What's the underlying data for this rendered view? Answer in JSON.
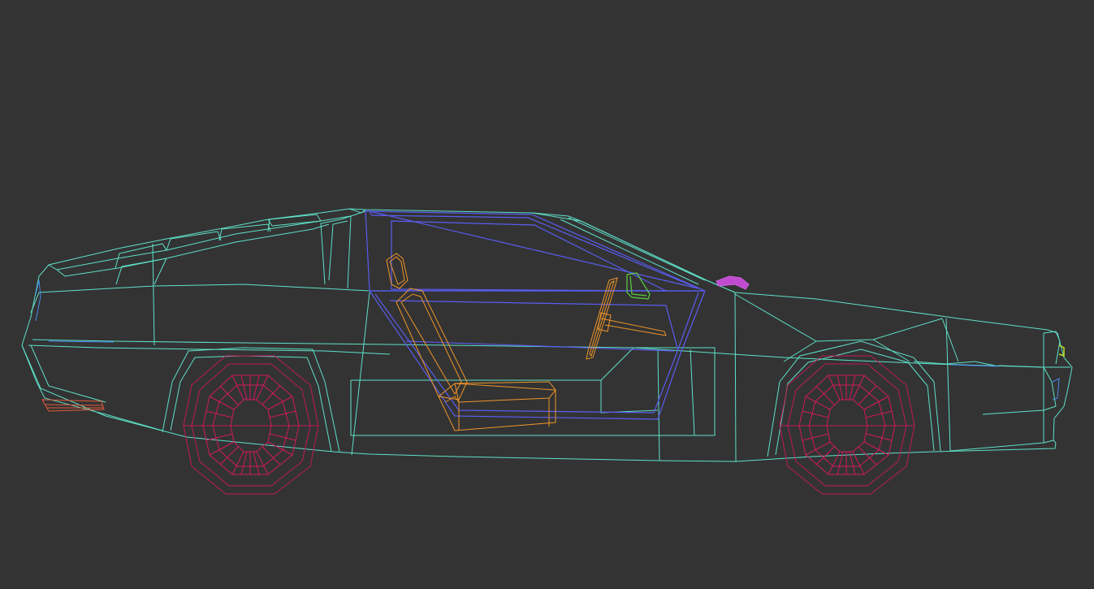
{
  "viewport": {
    "background": "#333333",
    "mode": "wireframe",
    "view": "side"
  },
  "scene": {
    "object": "sports-car",
    "parts": [
      {
        "name": "body-shell",
        "color": "#5ee0c8"
      },
      {
        "name": "door-and-window",
        "color": "#5a5cf0"
      },
      {
        "name": "interior-seat-steering",
        "color": "#f0962a"
      },
      {
        "name": "wheels",
        "color": "#c0195a"
      },
      {
        "name": "side-mirror",
        "color": "#d060e0"
      },
      {
        "name": "dash-part",
        "color": "#5ad040"
      },
      {
        "name": "tail-lamp",
        "color": "#e05a3a"
      },
      {
        "name": "head-lamp",
        "color": "#c8e020"
      }
    ]
  }
}
